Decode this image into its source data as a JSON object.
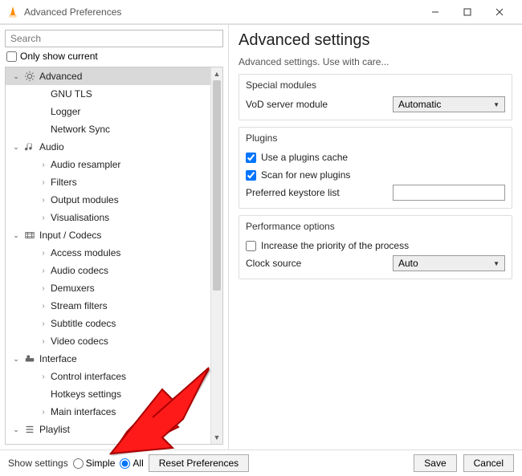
{
  "window": {
    "title": "Advanced Preferences",
    "min_icon": "minimize",
    "max_icon": "maximize",
    "close_icon": "close"
  },
  "search": {
    "placeholder": "Search"
  },
  "only_show_current": {
    "label": "Only show current",
    "checked": false
  },
  "tree": [
    {
      "level": 0,
      "caret": "down",
      "icon": "gear",
      "label": "Advanced",
      "selected": true
    },
    {
      "level": 1,
      "caret": "none",
      "icon": "none",
      "label": "GNU TLS"
    },
    {
      "level": 1,
      "caret": "none",
      "icon": "none",
      "label": "Logger"
    },
    {
      "level": 1,
      "caret": "none",
      "icon": "none",
      "label": "Network Sync"
    },
    {
      "level": 0,
      "caret": "down",
      "icon": "audio",
      "label": "Audio"
    },
    {
      "level": 1,
      "caret": "right",
      "icon": "none",
      "label": "Audio resampler"
    },
    {
      "level": 1,
      "caret": "right",
      "icon": "none",
      "label": "Filters"
    },
    {
      "level": 1,
      "caret": "right",
      "icon": "none",
      "label": "Output modules"
    },
    {
      "level": 1,
      "caret": "right",
      "icon": "none",
      "label": "Visualisations"
    },
    {
      "level": 0,
      "caret": "down",
      "icon": "codec",
      "label": "Input / Codecs"
    },
    {
      "level": 1,
      "caret": "right",
      "icon": "none",
      "label": "Access modules"
    },
    {
      "level": 1,
      "caret": "right",
      "icon": "none",
      "label": "Audio codecs"
    },
    {
      "level": 1,
      "caret": "right",
      "icon": "none",
      "label": "Demuxers"
    },
    {
      "level": 1,
      "caret": "right",
      "icon": "none",
      "label": "Stream filters"
    },
    {
      "level": 1,
      "caret": "right",
      "icon": "none",
      "label": "Subtitle codecs"
    },
    {
      "level": 1,
      "caret": "right",
      "icon": "none",
      "label": "Video codecs"
    },
    {
      "level": 0,
      "caret": "down",
      "icon": "interface",
      "label": "Interface"
    },
    {
      "level": 1,
      "caret": "right",
      "icon": "none",
      "label": "Control interfaces"
    },
    {
      "level": 1,
      "caret": "none",
      "icon": "none",
      "label": "Hotkeys settings"
    },
    {
      "level": 1,
      "caret": "right",
      "icon": "none",
      "label": "Main interfaces"
    },
    {
      "level": 0,
      "caret": "down",
      "icon": "playlist",
      "label": "Playlist"
    }
  ],
  "panel": {
    "title": "Advanced settings",
    "desc": "Advanced settings. Use with care...",
    "group_special": {
      "title": "Special modules",
      "vod_label": "VoD server module",
      "vod_value": "Automatic"
    },
    "group_plugins": {
      "title": "Plugins",
      "use_cache": {
        "label": "Use a plugins cache",
        "checked": true
      },
      "scan_new": {
        "label": "Scan for new plugins",
        "checked": true
      },
      "keystore_label": "Preferred keystore list",
      "keystore_value": ""
    },
    "group_perf": {
      "title": "Performance options",
      "inc_priority": {
        "label": "Increase the priority of the process",
        "checked": false
      },
      "clock_label": "Clock source",
      "clock_value": "Auto"
    }
  },
  "footer": {
    "show_settings_label": "Show settings",
    "simple_label": "Simple",
    "all_label": "All",
    "selected": "all",
    "reset_label": "Reset Preferences",
    "save_label": "Save",
    "cancel_label": "Cancel"
  }
}
